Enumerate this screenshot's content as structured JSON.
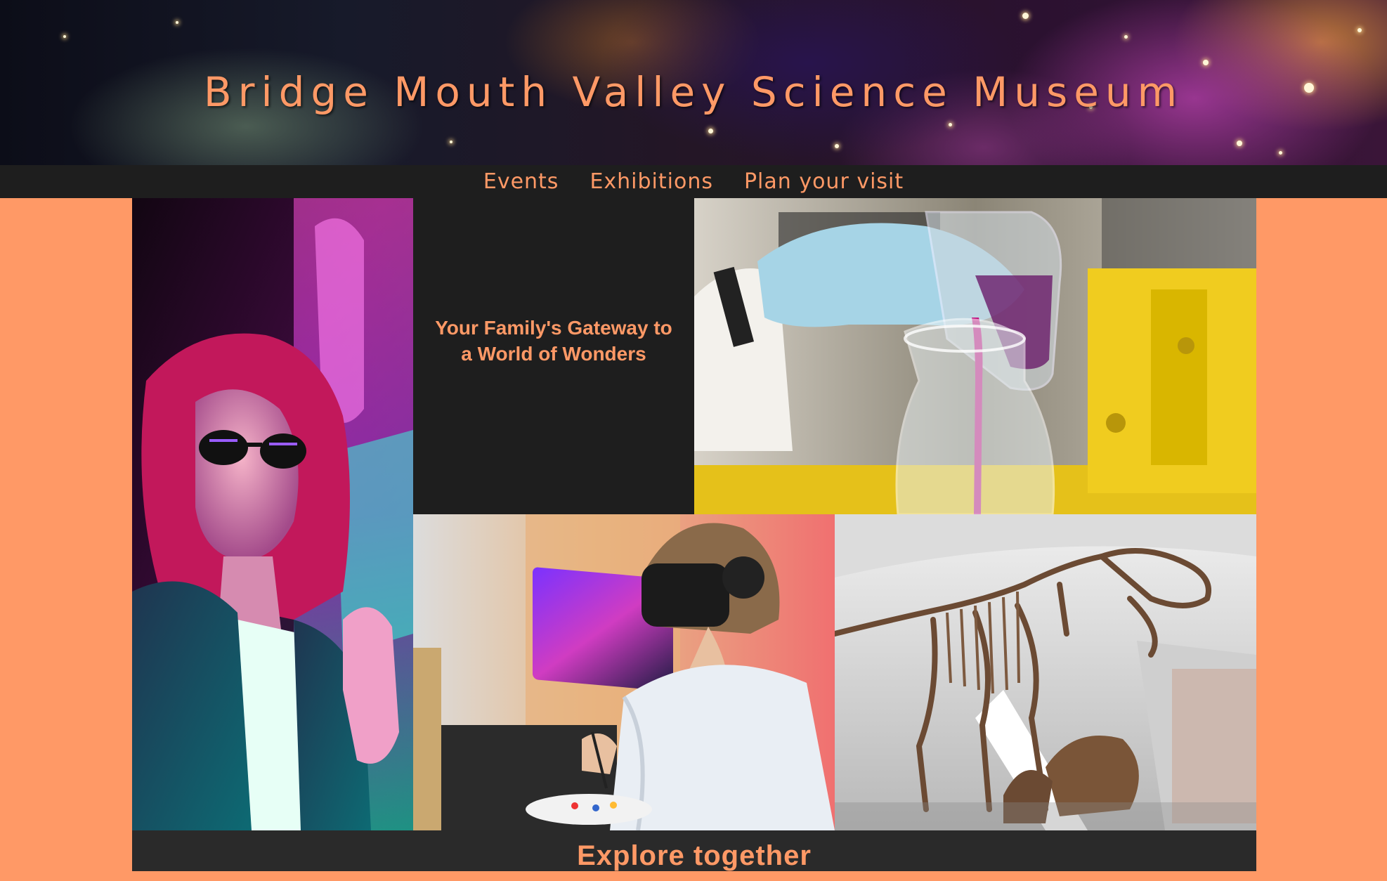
{
  "header": {
    "title": "Bridge Mouth Valley Science Museum"
  },
  "nav": {
    "items": [
      {
        "label": "Events"
      },
      {
        "label": "Exhibitions"
      },
      {
        "label": "Plan your visit"
      }
    ]
  },
  "hero": {
    "tagline": "Your Family's Gateway to a World of Wonders",
    "images": [
      {
        "icon": "woman-neon-light-photo"
      },
      {
        "icon": "chemistry-beaker-photo"
      },
      {
        "icon": "vr-headset-painter-photo"
      },
      {
        "icon": "dinosaur-skeleton-photo"
      }
    ]
  },
  "section": {
    "heading": "Explore together"
  },
  "colors": {
    "accent": "#FF9966",
    "dark": "#1e1e1e"
  }
}
